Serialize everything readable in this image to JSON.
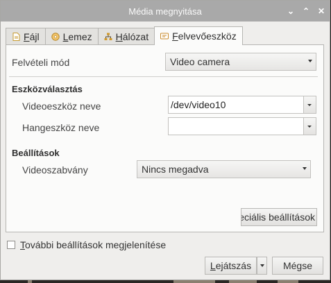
{
  "window": {
    "title": "Média megnyitása",
    "controls": [
      "chevron-down-icon",
      "chevron-up-icon",
      "close-icon"
    ]
  },
  "tabs": [
    {
      "label_prefix": "",
      "mnemonic": "F",
      "label_rest": "ájl",
      "icon": "file-icon"
    },
    {
      "label_prefix": "",
      "mnemonic": "L",
      "label_rest": "emez",
      "icon": "disc-icon"
    },
    {
      "label_prefix": "",
      "mnemonic": "H",
      "label_rest": "álózat",
      "icon": "network-icon"
    },
    {
      "label_prefix": "",
      "mnemonic": "F",
      "label_rest": "elvevőeszköz",
      "icon": "capture-device-icon",
      "active": true
    }
  ],
  "capture_mode": {
    "label": "Felvételi mód",
    "value": "Video camera"
  },
  "device_section": {
    "title": "Eszközválasztás",
    "video_device": {
      "label": "Videoeszköz neve",
      "value": "/dev/video10"
    },
    "audio_device": {
      "label": "Hangeszköz neve",
      "value": ""
    }
  },
  "settings_section": {
    "title": "Beállítások",
    "video_standard": {
      "label": "Videoszabvány",
      "value": "Nincs megadva"
    }
  },
  "advanced_button": "peciális beállítások",
  "show_more": {
    "prefix": "",
    "mnemonic": "T",
    "rest": "ovábbi beállítások megjelenítése",
    "checked": false
  },
  "play_button": {
    "mnemonic": "L",
    "rest": "ejátszás"
  },
  "cancel_button": {
    "prefix": "Mé",
    "mnemonic": "g",
    "rest": "se"
  }
}
